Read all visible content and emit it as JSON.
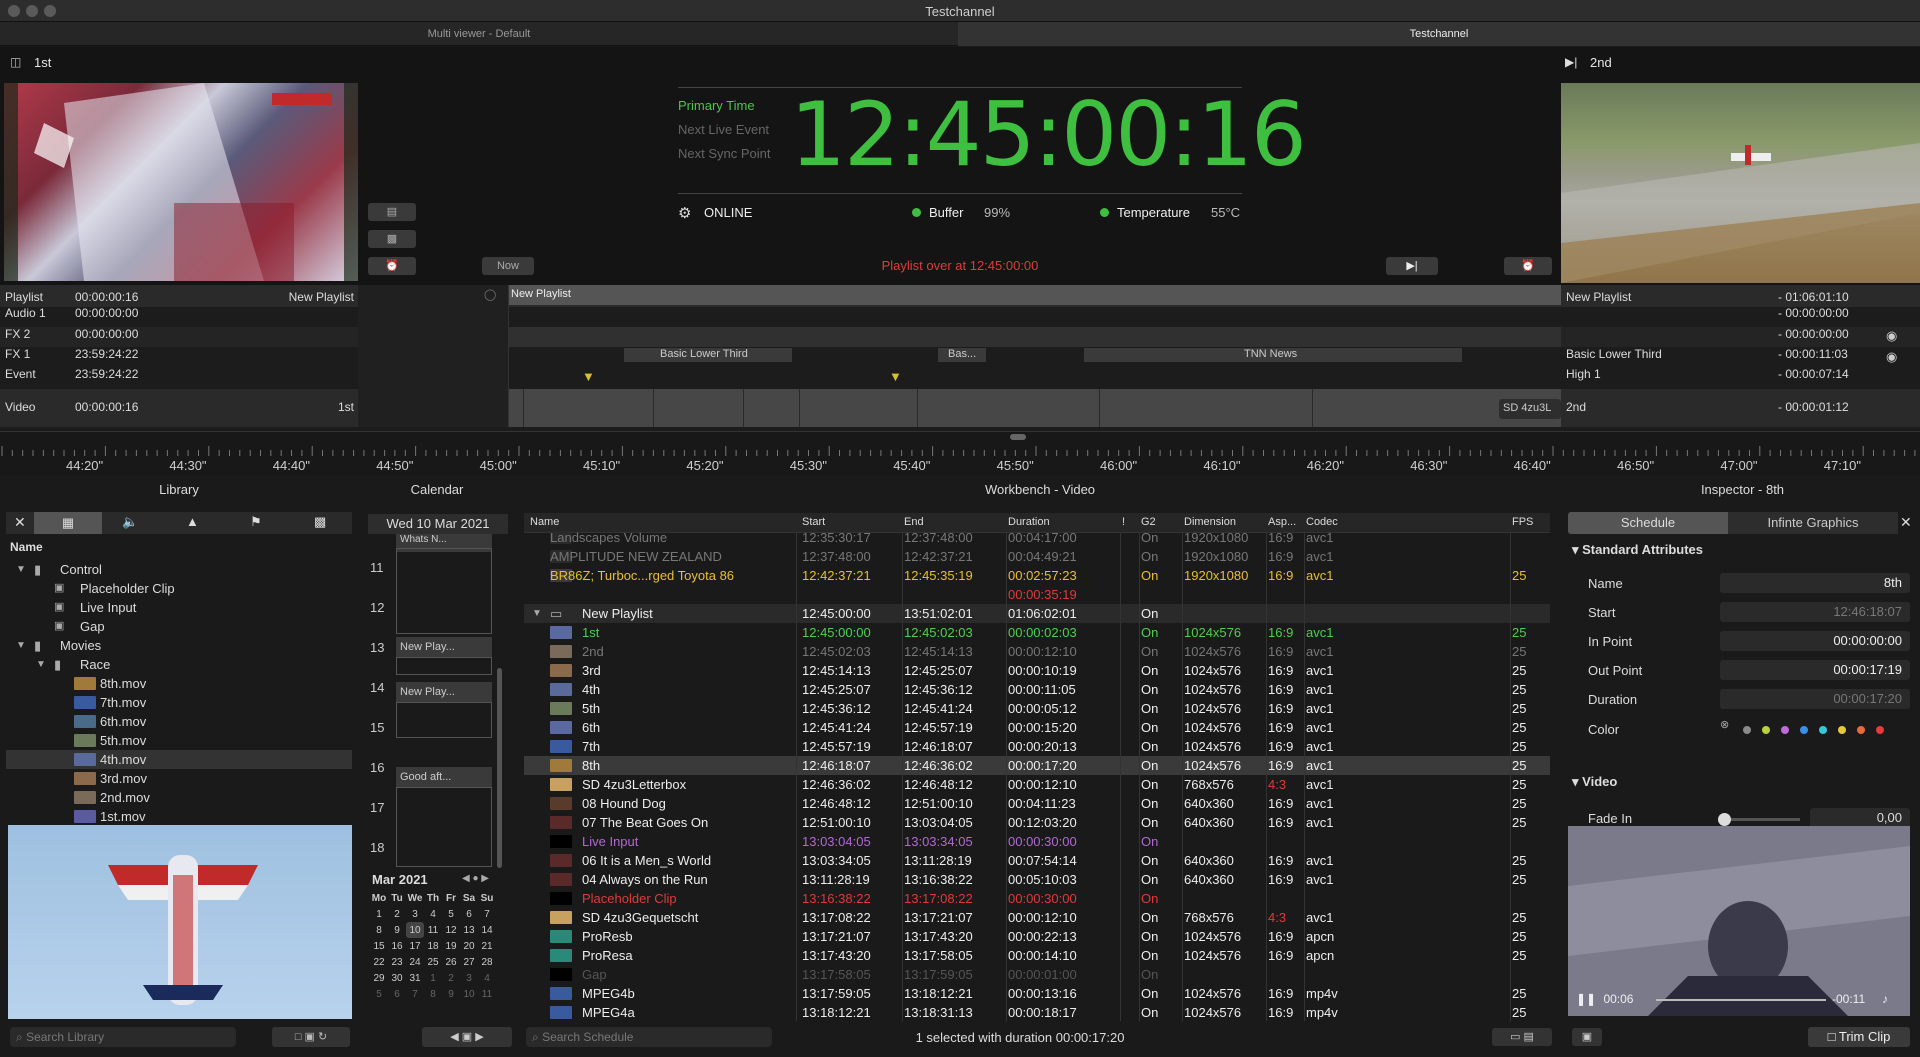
{
  "window": {
    "title": "Testchannel"
  },
  "tabs": [
    {
      "label": "Multi viewer - Default"
    },
    {
      "label": "Testchannel"
    }
  ],
  "viewer": {
    "left_label": "1st",
    "right_label": "2nd",
    "primary_time_label": "Primary Time",
    "next_live_label": "Next Live Event",
    "next_sync_label": "Next Sync Point",
    "clock": "12:45:00:16",
    "status": "ONLINE",
    "buffer_label": "Buffer",
    "buffer_value": "99%",
    "temp_label": "Temperature",
    "temp_value": "55°C",
    "now_button": "Now",
    "playlist_over": "Playlist over at 12:45:00:00"
  },
  "tracks": [
    {
      "name": "Playlist",
      "time": "00:00:00:16",
      "right": "New Playlist",
      "r_name": "New Playlist",
      "r_time": "- 01:06:01:10"
    },
    {
      "name": "Audio 1",
      "time": "00:00:00:00",
      "right": "",
      "r_name": "",
      "r_time": "- 00:00:00:00"
    },
    {
      "name": "FX 2",
      "time": "00:00:00:00",
      "right": "",
      "r_name": "",
      "r_time": "- 00:00:00:00"
    },
    {
      "name": "FX 1",
      "time": "23:59:24:22",
      "right": "",
      "r_name": "Basic Lower Third",
      "r_time": "- 00:00:11:03"
    },
    {
      "name": "Event",
      "time": "23:59:24:22",
      "right": "",
      "r_name": "High 1",
      "r_time": "- 00:00:07:14"
    },
    {
      "name": "Video",
      "time": "00:00:00:16",
      "right": "1st",
      "r_name": "2nd",
      "r_time": "- 00:00:01:12"
    }
  ],
  "timeline_blocks": {
    "playlist": "New Playlist",
    "fx1_a": "Basic Lower Third",
    "fx1_b": "Bas...",
    "fx1_c": "TNN News",
    "video_end": "SD 4zu3L"
  },
  "ruler": [
    "44:20\"",
    "44:30\"",
    "44:40\"",
    "44:50\"",
    "45:00\"",
    "45:10\"",
    "45:20\"",
    "45:30\"",
    "45:40\"",
    "45:50\"",
    "46:00\"",
    "46:10\"",
    "46:20\"",
    "46:30\"",
    "46:40\"",
    "46:50\"",
    "47:00\"",
    "47:10\""
  ],
  "library": {
    "title": "Library",
    "name_header": "Name",
    "items": [
      {
        "label": "Control",
        "level": 0,
        "kind": "folder"
      },
      {
        "label": "Placeholder Clip",
        "level": 1,
        "kind": "control"
      },
      {
        "label": "Live Input",
        "level": 1,
        "kind": "control"
      },
      {
        "label": "Gap",
        "level": 1,
        "kind": "control"
      },
      {
        "label": "Movies",
        "level": 0,
        "kind": "folder"
      },
      {
        "label": "Race",
        "level": 1,
        "kind": "folder"
      },
      {
        "label": "8th.mov",
        "level": 2,
        "kind": "clip"
      },
      {
        "label": "7th.mov",
        "level": 2,
        "kind": "clip"
      },
      {
        "label": "6th.mov",
        "level": 2,
        "kind": "clip"
      },
      {
        "label": "5th.mov",
        "level": 2,
        "kind": "clip"
      },
      {
        "label": "4th.mov",
        "level": 2,
        "kind": "clip"
      },
      {
        "label": "3rd.mov",
        "level": 2,
        "kind": "clip"
      },
      {
        "label": "2nd.mov",
        "level": 2,
        "kind": "clip"
      },
      {
        "label": "1st.mov",
        "level": 2,
        "kind": "clip"
      }
    ],
    "search_placeholder": "Search Library"
  },
  "calendar": {
    "title": "Calendar",
    "date": "Wed 10 Mar 2021",
    "hours": [
      "11",
      "12",
      "13",
      "14",
      "15",
      "16",
      "17",
      "18"
    ],
    "events": [
      "Whats N...",
      "New Play...",
      "New Play...",
      "Good aft..."
    ],
    "month": "Mar 2021",
    "weekdays": [
      "Mo",
      "Tu",
      "We",
      "Th",
      "Fr",
      "Sa",
      "Su"
    ],
    "weeks": [
      [
        "1",
        "2",
        "3",
        "4",
        "5",
        "6",
        "7"
      ],
      [
        "8",
        "9",
        "10",
        "11",
        "12",
        "13",
        "14"
      ],
      [
        "15",
        "16",
        "17",
        "18",
        "19",
        "20",
        "21"
      ],
      [
        "22",
        "23",
        "24",
        "25",
        "26",
        "27",
        "28"
      ],
      [
        "29",
        "30",
        "31",
        "1",
        "2",
        "3",
        "4"
      ],
      [
        "5",
        "6",
        "7",
        "8",
        "9",
        "10",
        "11"
      ]
    ]
  },
  "workbench": {
    "title": "Workbench - Video",
    "columns": [
      "Name",
      "Start",
      "End",
      "Duration",
      "!",
      "G2",
      "Dimension",
      "Asp...",
      "Codec",
      "FPS"
    ],
    "rows": [
      {
        "name": "Landscapes Volume",
        "start": "12:35:30:17",
        "end": "12:37:48:00",
        "dur": "00:04:17:00",
        "g2": "On",
        "dim": "1920x1080",
        "asp": "16:9",
        "codec": "avc1",
        "fps": "",
        "style": "dim"
      },
      {
        "name": "AMPLITUDE NEW ZEALAND",
        "start": "12:37:48:00",
        "end": "12:42:37:21",
        "dur": "00:04:49:21",
        "g2": "On",
        "dim": "1920x1080",
        "asp": "16:9",
        "codec": "avc1",
        "fps": "",
        "style": "dim"
      },
      {
        "name": "BR86Z; Turboc...rged Toyota 86",
        "start": "12:42:37:21",
        "end": "12:45:35:19",
        "dur": "00:02:57:23",
        "g2": "On",
        "dim": "1920x1080",
        "asp": "16:9",
        "codec": "avc1",
        "fps": "25",
        "style": "yellow"
      },
      {
        "name": "",
        "start": "",
        "end": "",
        "dur": "00:00:35:19",
        "g2": "",
        "dim": "",
        "asp": "",
        "codec": "",
        "fps": "",
        "style": "red"
      },
      {
        "name": "New Playlist",
        "start": "12:45:00:00",
        "end": "13:51:02:01",
        "dur": "01:06:02:01",
        "g2": "On",
        "dim": "",
        "asp": "",
        "codec": "",
        "fps": "",
        "style": "group"
      },
      {
        "name": "1st",
        "start": "12:45:00:00",
        "end": "12:45:02:03",
        "dur": "00:00:02:03",
        "g2": "On",
        "dim": "1024x576",
        "asp": "16:9",
        "codec": "avc1",
        "fps": "25",
        "style": "green"
      },
      {
        "name": "2nd",
        "start": "12:45:02:03",
        "end": "12:45:14:13",
        "dur": "00:00:12:10",
        "g2": "On",
        "dim": "1024x576",
        "asp": "16:9",
        "codec": "avc1",
        "fps": "25",
        "style": "dim"
      },
      {
        "name": "3rd",
        "start": "12:45:14:13",
        "end": "12:45:25:07",
        "dur": "00:00:10:19",
        "g2": "On",
        "dim": "1024x576",
        "asp": "16:9",
        "codec": "avc1",
        "fps": "25",
        "style": ""
      },
      {
        "name": "4th",
        "start": "12:45:25:07",
        "end": "12:45:36:12",
        "dur": "00:00:11:05",
        "g2": "On",
        "dim": "1024x576",
        "asp": "16:9",
        "codec": "avc1",
        "fps": "25",
        "style": ""
      },
      {
        "name": "5th",
        "start": "12:45:36:12",
        "end": "12:45:41:24",
        "dur": "00:00:05:12",
        "g2": "On",
        "dim": "1024x576",
        "asp": "16:9",
        "codec": "avc1",
        "fps": "25",
        "style": ""
      },
      {
        "name": "6th",
        "start": "12:45:41:24",
        "end": "12:45:57:19",
        "dur": "00:00:15:20",
        "g2": "On",
        "dim": "1024x576",
        "asp": "16:9",
        "codec": "avc1",
        "fps": "25",
        "style": ""
      },
      {
        "name": "7th",
        "start": "12:45:57:19",
        "end": "12:46:18:07",
        "dur": "00:00:20:13",
        "g2": "On",
        "dim": "1024x576",
        "asp": "16:9",
        "codec": "avc1",
        "fps": "25",
        "style": ""
      },
      {
        "name": "8th",
        "start": "12:46:18:07",
        "end": "12:46:36:02",
        "dur": "00:00:17:20",
        "g2": "On",
        "dim": "1024x576",
        "asp": "16:9",
        "codec": "avc1",
        "fps": "25",
        "style": "selected"
      },
      {
        "name": "SD 4zu3Letterbox",
        "start": "12:46:36:02",
        "end": "12:46:48:12",
        "dur": "00:00:12:10",
        "g2": "On",
        "dim": "768x576",
        "asp": "4:3",
        "codec": "avc1",
        "fps": "25",
        "style": "aspred"
      },
      {
        "name": "08 Hound Dog",
        "start": "12:46:48:12",
        "end": "12:51:00:10",
        "dur": "00:04:11:23",
        "g2": "On",
        "dim": "640x360",
        "asp": "16:9",
        "codec": "avc1",
        "fps": "25",
        "style": ""
      },
      {
        "name": "07 The Beat Goes On",
        "start": "12:51:00:10",
        "end": "13:03:04:05",
        "dur": "00:12:03:20",
        "g2": "On",
        "dim": "640x360",
        "asp": "16:9",
        "codec": "avc1",
        "fps": "25",
        "style": ""
      },
      {
        "name": "Live Input",
        "start": "13:03:04:05",
        "end": "13:03:34:05",
        "dur": "00:00:30:00",
        "g2": "On",
        "dim": "",
        "asp": "",
        "codec": "",
        "fps": "",
        "style": "purple"
      },
      {
        "name": "06 It is a Men_s World",
        "start": "13:03:34:05",
        "end": "13:11:28:19",
        "dur": "00:07:54:14",
        "g2": "On",
        "dim": "640x360",
        "asp": "16:9",
        "codec": "avc1",
        "fps": "25",
        "style": ""
      },
      {
        "name": "04 Always on the Run",
        "start": "13:11:28:19",
        "end": "13:16:38:22",
        "dur": "00:05:10:03",
        "g2": "On",
        "dim": "640x360",
        "asp": "16:9",
        "codec": "avc1",
        "fps": "25",
        "style": ""
      },
      {
        "name": "Placeholder Clip",
        "start": "13:16:38:22",
        "end": "13:17:08:22",
        "dur": "00:00:30:00",
        "g2": "On",
        "dim": "",
        "asp": "",
        "codec": "",
        "fps": "",
        "style": "redtext"
      },
      {
        "name": "SD 4zu3Gequetscht",
        "start": "13:17:08:22",
        "end": "13:17:21:07",
        "dur": "00:00:12:10",
        "g2": "On",
        "dim": "768x576",
        "asp": "4:3",
        "codec": "avc1",
        "fps": "25",
        "style": "aspred"
      },
      {
        "name": "ProResb",
        "start": "13:17:21:07",
        "end": "13:17:43:20",
        "dur": "00:00:22:13",
        "g2": "On",
        "dim": "1024x576",
        "asp": "16:9",
        "codec": "apcn",
        "fps": "25",
        "style": ""
      },
      {
        "name": "ProResa",
        "start": "13:17:43:20",
        "end": "13:17:58:05",
        "dur": "00:00:14:10",
        "g2": "On",
        "dim": "1024x576",
        "asp": "16:9",
        "codec": "apcn",
        "fps": "25",
        "style": ""
      },
      {
        "name": "Gap",
        "start": "13:17:58:05",
        "end": "13:17:59:05",
        "dur": "00:00:01:00",
        "g2": "On",
        "dim": "",
        "asp": "",
        "codec": "",
        "fps": "",
        "style": "verydim"
      },
      {
        "name": "MPEG4b",
        "start": "13:17:59:05",
        "end": "13:18:12:21",
        "dur": "00:00:13:16",
        "g2": "On",
        "dim": "1024x576",
        "asp": "16:9",
        "codec": "mp4v",
        "fps": "25",
        "style": ""
      },
      {
        "name": "MPEG4a",
        "start": "13:18:12:21",
        "end": "13:18:31:13",
        "dur": "00:00:18:17",
        "g2": "On",
        "dim": "1024x576",
        "asp": "16:9",
        "codec": "mp4v",
        "fps": "25",
        "style": ""
      }
    ],
    "search_placeholder": "Search Schedule",
    "status": "1 selected with duration 00:00:17:20"
  },
  "inspector": {
    "title": "Inspector - 8th",
    "tab_schedule": "Schedule",
    "tab_graphics": "Infinte Graphics",
    "section_standard": "Standard Attributes",
    "fields": [
      {
        "label": "Name",
        "value": "8th",
        "dim": false
      },
      {
        "label": "Start",
        "value": "12:46:18:07",
        "dim": true
      },
      {
        "label": "In Point",
        "value": "00:00:00:00",
        "dim": false
      },
      {
        "label": "Out Point",
        "value": "00:00:17:19",
        "dim": false
      },
      {
        "label": "Duration",
        "value": "00:00:17:20",
        "dim": true
      }
    ],
    "color_label": "Color",
    "colors": [
      "#8a8a8a",
      "#b7d23a",
      "#c06ad8",
      "#3a8fe8",
      "#35c9d6",
      "#e8c83a",
      "#e86a3a",
      "#e83a3a"
    ],
    "section_video": "Video",
    "fade_label": "Fade In",
    "fade_value": "0,00",
    "preview_time": "00:06",
    "preview_remaining": "-00:11",
    "trim_button": "Trim Clip"
  },
  "icons": [
    "lock-icon",
    "skip-end-icon",
    "cc-icon",
    "chart-icon",
    "alarm-icon",
    "gear-icon",
    "eye-icon",
    "close-icon",
    "film-icon",
    "speaker-icon",
    "mountain-icon",
    "flag-icon",
    "calendar-icon",
    "search-icon"
  ]
}
